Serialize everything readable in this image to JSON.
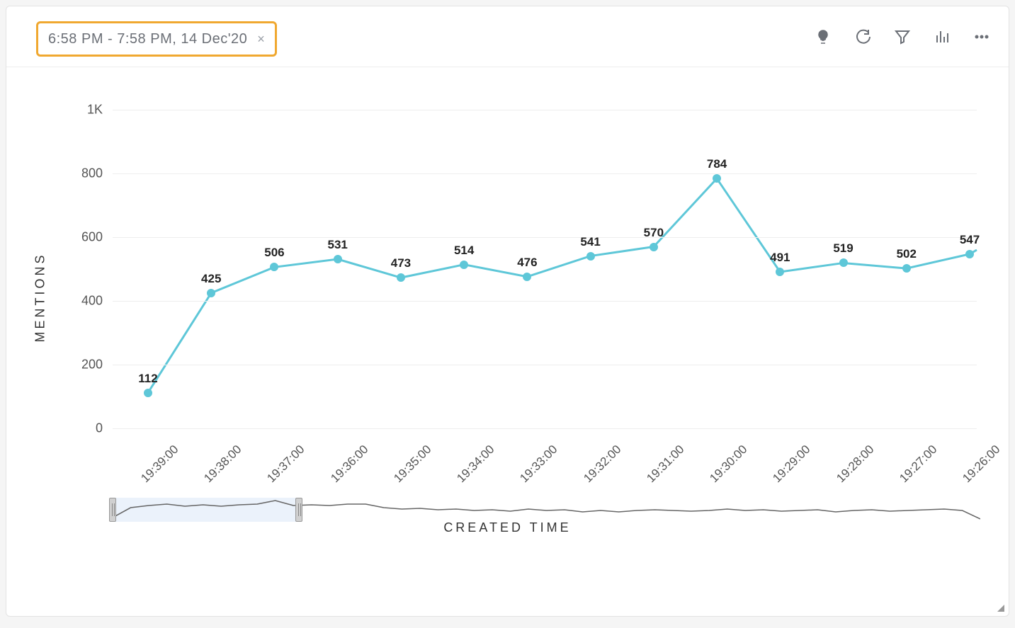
{
  "header": {
    "date_range": "6:58 PM - 7:58 PM, 14 Dec'20",
    "close_glyph": "×"
  },
  "toolbar": {
    "insights_tip": "Insights",
    "refresh_tip": "Refresh",
    "filter_tip": "Filter",
    "chartopts_tip": "Chart options",
    "more_tip": "More"
  },
  "chart_data": {
    "type": "line",
    "title": "",
    "ylabel": "MENTIONS",
    "xlabel": "CREATED TIME",
    "ylim": [
      0,
      1000
    ],
    "y_ticks": [
      0,
      200,
      400,
      600,
      800,
      1000
    ],
    "y_tick_labels": [
      "0",
      "200",
      "400",
      "600",
      "800",
      "1K"
    ],
    "categories": [
      "19:39:00",
      "19:38:00",
      "19:37:00",
      "19:36:00",
      "19:35:00",
      "19:34:00",
      "19:33:00",
      "19:32:00",
      "19:31:00",
      "19:30:00",
      "19:29:00",
      "19:28:00",
      "19:27:00",
      "19:26:00"
    ],
    "values": [
      112,
      425,
      506,
      531,
      473,
      514,
      476,
      541,
      570,
      784,
      491,
      519,
      502,
      547
    ],
    "trailing_value": 560
  },
  "scrubber": {
    "selection_start_fraction": 0.0,
    "selection_end_fraction": 0.215
  }
}
